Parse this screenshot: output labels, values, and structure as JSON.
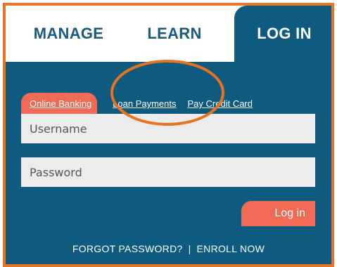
{
  "tabs": {
    "manage": "MANAGE",
    "learn": "LEARN",
    "login": "LOG IN"
  },
  "subtabs": {
    "online_banking": "Online Banking",
    "loan_payments": "Loan Payments",
    "pay_credit_card": "Pay Credit Card"
  },
  "form": {
    "username_placeholder": "Username",
    "password_placeholder": "Password",
    "login_button": "Log in"
  },
  "footer_links": {
    "forgot_password": "FORGOT PASSWORD?",
    "separator": "|",
    "enroll_now": "ENROLL NOW"
  },
  "colors": {
    "brand_blue": "#0f5b80",
    "accent_coral": "#f06a55",
    "frame_orange": "#ea7425",
    "annotation_orange": "#e8731f"
  }
}
